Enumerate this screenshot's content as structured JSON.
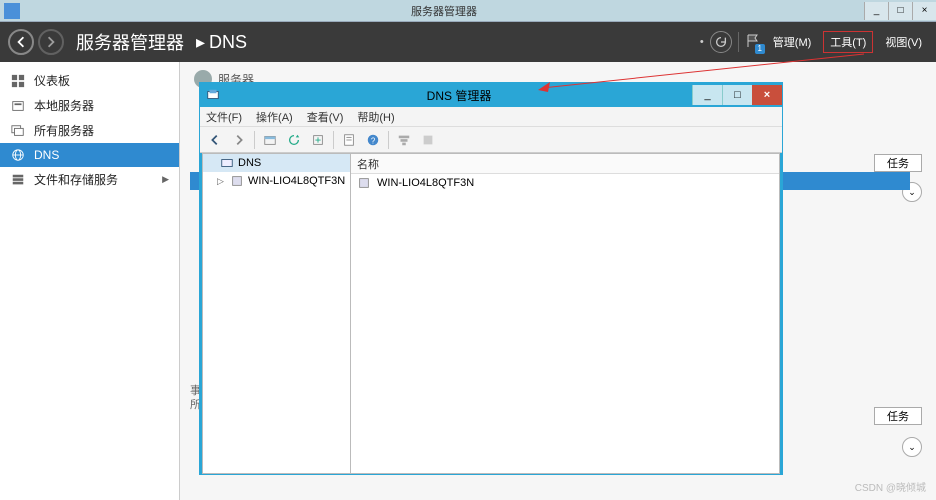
{
  "outer_window": {
    "title": "服务器管理器"
  },
  "window_controls": {
    "min": "_",
    "max": "□",
    "close": "×"
  },
  "server_manager": {
    "title": "服务器管理器",
    "breadcrumb_sep": "▸",
    "breadcrumb_current": "DNS",
    "right_menu": {
      "manage": "管理(M)",
      "tools": "工具(T)",
      "view": "视图(V)"
    }
  },
  "sidebar": {
    "items": [
      {
        "label": "仪表板"
      },
      {
        "label": "本地服务器"
      },
      {
        "label": "所有服务器"
      },
      {
        "label": "DNS",
        "selected": true
      },
      {
        "label": "文件和存储服务",
        "has_children": true
      }
    ]
  },
  "content": {
    "servers_label": "服务器",
    "tasks_label": "任务",
    "section2_line1": "事",
    "section2_line2": "所"
  },
  "dns_manager": {
    "title": "DNS 管理器",
    "menus": {
      "file": "文件(F)",
      "action": "操作(A)",
      "view": "查看(V)",
      "help": "帮助(H)"
    },
    "tree": {
      "root": "DNS",
      "node": "WIN-LIO4L8QTF3N"
    },
    "list": {
      "column_name": "名称",
      "item": "WIN-LIO4L8QTF3N"
    }
  },
  "watermark": "CSDN @晓倾城"
}
